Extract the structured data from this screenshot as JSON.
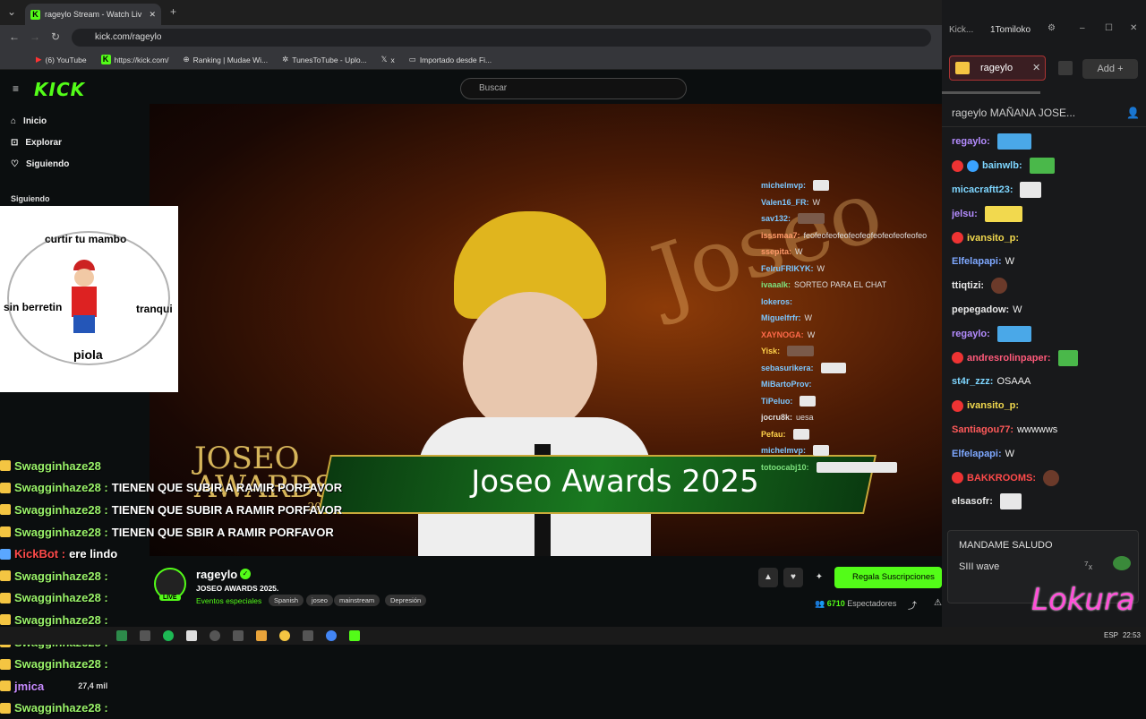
{
  "browser": {
    "tab_title": "rageylo Stream - Watch Liv",
    "url": "kick.com/rageylo",
    "bookmarks": [
      "(6) YouTube",
      "https://kick.com/",
      "Ranking | Mudae Wi...",
      "TunesToTube - Uplo...",
      "x",
      "Importado desde Fi..."
    ]
  },
  "site": {
    "logo": "KICK",
    "search_placeholder": "Buscar",
    "nav": [
      "Inicio",
      "Explorar",
      "Siguiendo"
    ],
    "following_heading": "Siguiendo"
  },
  "meme": {
    "top": "curtir tu mambo",
    "left": "sin berretin",
    "right": "tranqui",
    "bottom": "piola"
  },
  "video": {
    "banner_text": "Joseo Awards 2025",
    "logo_text_1": "JOSEO",
    "logo_text_2": "AWARDS",
    "logo_year": "2025",
    "overlay_chat": [
      {
        "user": "michelmvp:",
        "text": ""
      },
      {
        "user": "Valen16_FR:",
        "text": "W"
      },
      {
        "user": "sav132:",
        "text": ""
      },
      {
        "user": "isssmaa7:",
        "text": "feofeofeofeofeofeofeofeofeofeofeo"
      },
      {
        "user": "ssepita:",
        "text": "W"
      },
      {
        "user": "FelruFRIKYK:",
        "text": "W"
      },
      {
        "user": "ivaaalk:",
        "text": "SORTEO PARA EL CHAT"
      },
      {
        "user": "lokeros:",
        "text": ""
      },
      {
        "user": "Miguelfrfr:",
        "text": "W"
      },
      {
        "user": "XAYNOGA:",
        "text": "W"
      },
      {
        "user": "Yisk:",
        "text": ""
      },
      {
        "user": "sebasurikera:",
        "text": ""
      },
      {
        "user": "MiBartoProv:",
        "text": ""
      },
      {
        "user": "TiPeluo:",
        "text": ""
      },
      {
        "user": "jocru8k:",
        "text": "uesa"
      },
      {
        "user": "Pefau:",
        "text": ""
      },
      {
        "user": "michelmvp:",
        "text": ""
      },
      {
        "user": "totoocabj10:",
        "text": ""
      }
    ],
    "swag_lines": [
      {
        "user": "Swagginhaze28",
        "msg": ""
      },
      {
        "user": "Swagginhaze28 :",
        "msg": "TIENEN QUE SUBIR A RAMIR PORFAVOR"
      },
      {
        "user": "Swagginhaze28 :",
        "msg": "TIENEN QUE SUBIR A RAMIR PORFAVOR"
      },
      {
        "user": "Swagginhaze28 :",
        "msg": "TIENEN QUE SBIR A RAMIR PORFAVOR"
      },
      {
        "user": "KickBot :",
        "msg": "ere lindo"
      },
      {
        "user": "Swagginhaze28 :",
        "msg": ""
      },
      {
        "user": "Swagginhaze28 :",
        "msg": ""
      },
      {
        "user": "Swagginhaze28 :",
        "msg": ""
      },
      {
        "user": "Swagginhaze28 :",
        "msg": ""
      },
      {
        "user": "Swagginhaze28 :",
        "msg": ""
      },
      {
        "user": "jmica",
        "msg": ""
      },
      {
        "user": "Swagginhaze28 :",
        "msg": ""
      }
    ],
    "swag_side": {
      "count": "27,4 mil"
    }
  },
  "stream_info": {
    "streamer": "rageylo",
    "live_label": "LIVE",
    "title": "JOSEO AWARDS 2025.",
    "category": "Eventos especiales",
    "tags": [
      "Spanish",
      "joseo",
      "mainstream",
      "Depresión"
    ],
    "sub_button": "Regala Suscripciones",
    "viewers_count": "6710",
    "viewers_label": "Espectadores"
  },
  "chat_window": {
    "top_left": "Kick...",
    "account": "1Tomiloko",
    "channel_tab": "rageylo",
    "add_label": "Add",
    "header": "rageylo   MAÑANA JOSE...",
    "messages": [
      {
        "user": "regaylo:",
        "text": "",
        "color": "#b48cff"
      },
      {
        "user": "bainwlb:",
        "text": "",
        "color": "#7ed6ff"
      },
      {
        "user": "micacraftt23:",
        "text": "",
        "color": "#7ed6ff"
      },
      {
        "user": "jelsu:",
        "text": "",
        "color": "#b48cff"
      },
      {
        "user": "ivansito_p:",
        "text": "",
        "color": "#f2d94e"
      },
      {
        "user": "Elfelapapi:",
        "text": "W",
        "color": "#7ea8ff"
      },
      {
        "user": "ttiqtizi:",
        "text": "",
        "color": "#e8e8e8"
      },
      {
        "user": "pepegadow:",
        "text": "W",
        "color": "#e8e8e8"
      },
      {
        "user": "regaylo:",
        "text": "",
        "color": "#b48cff"
      },
      {
        "user": "andresrolinpaper:",
        "text": "",
        "color": "#ff5a7a"
      },
      {
        "user": "st4r_zzz:",
        "text": "OSAAA",
        "color": "#7ed6ff"
      },
      {
        "user": "ivansito_p:",
        "text": "",
        "color": "#f2d94e"
      },
      {
        "user": "Santiagou77:",
        "text": "wwwwws",
        "color": "#ff5a5a"
      },
      {
        "user": "Elfelapapi:",
        "text": "W",
        "color": "#7ea8ff"
      },
      {
        "user": "BAKKROOMS:",
        "text": "",
        "color": "#ff4a4a"
      },
      {
        "user": "elsasofr:",
        "text": "",
        "color": "#e8e8e8"
      }
    ],
    "pinned_title": "MANDAME SALUDO",
    "pinned_text": "SIII  wave",
    "overlay_word": "Lokura"
  },
  "taskbar": {
    "lang": "ESP",
    "time": "22:53"
  },
  "colors": {
    "kick_green": "#53fc18",
    "chat_bg": "#18191b"
  }
}
